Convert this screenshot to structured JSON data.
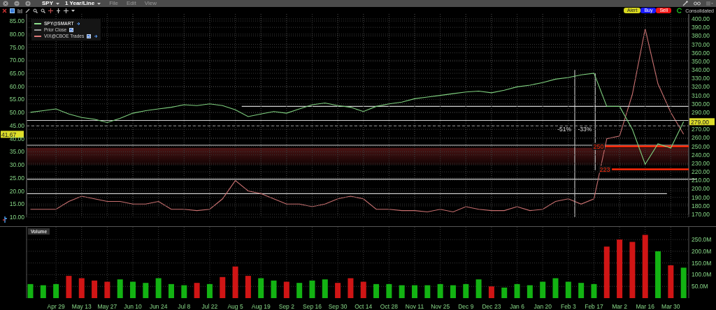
{
  "title_bar": {
    "symbol": "SPY",
    "period": "1 Year/Line",
    "menus": [
      "File",
      "Edit",
      "View"
    ]
  },
  "toolbar": {
    "order_buttons": [
      {
        "label": "Alert",
        "kind": "alert"
      },
      {
        "label": "Buy",
        "kind": "buy"
      },
      {
        "label": "Sell",
        "kind": "sell"
      }
    ],
    "data_source": "Consolidated"
  },
  "legend": [
    {
      "label": "SPY@SMART",
      "kind": "solid",
      "color": "#8ee08e",
      "checked": false,
      "pinned": true
    },
    {
      "label": "Prior Close",
      "kind": "dashed",
      "color": "#9a9a9a",
      "checked": true,
      "pinned": false
    },
    {
      "label": "VIX@CBOE Trades",
      "kind": "solid",
      "color": "#e07a7a",
      "checked": true,
      "pinned": true
    }
  ],
  "price_pane": {
    "vix_plot": {
      "chart_data": {
        "type": "line",
        "categories": [
          null,
          null,
          null,
          null,
          null,
          null,
          null,
          null,
          null,
          null,
          null,
          null,
          null,
          null,
          null,
          null,
          null,
          null,
          null,
          null,
          null,
          null,
          null,
          null,
          null,
          null,
          null,
          null,
          null,
          null,
          null,
          null,
          null,
          null,
          null,
          null,
          null,
          null,
          null,
          null,
          null,
          null,
          null,
          null,
          null,
          null,
          null,
          null,
          null,
          null,
          null,
          null
        ],
        "series": [
          {
            "color": "#c97070",
            "values": [
              13,
              13,
              13,
              16,
              18,
              17,
              16,
              16,
              15,
              15,
              16,
              13,
              13,
              12.5,
              13,
              17,
              24,
              20,
              19,
              17,
              15,
              15,
              14,
              15,
              17,
              18,
              17,
              13,
              13,
              12.5,
              12.5,
              12,
              13,
              12,
              14,
              13,
              12.5,
              12.5,
              14,
              12.5,
              13,
              16,
              17,
              15,
              17,
              40,
              41,
              57,
              82,
              61,
              50,
              41.7
            ]
          }
        ],
        "ylim": [
          10,
          87.7
        ],
        "grid": true,
        "yticks": [
          {
            "value": 85,
            "label": "85.00"
          },
          {
            "value": 80,
            "label": "80.00"
          },
          {
            "value": 75,
            "label": "75.00"
          },
          {
            "value": 70,
            "label": "70.00"
          },
          {
            "value": 65,
            "label": "65.00"
          },
          {
            "value": 60,
            "label": "60.00"
          },
          {
            "value": 55,
            "label": "55.00"
          },
          {
            "value": 50,
            "label": "50.00"
          },
          {
            "value": 45,
            "label": "45.00"
          },
          {
            "value": 40,
            "label": "40.00"
          },
          {
            "value": 35,
            "label": "35.00"
          },
          {
            "value": 30,
            "label": "30.00"
          },
          {
            "value": 25,
            "label": "25.00"
          },
          {
            "value": 20,
            "label": "20.00"
          },
          {
            "value": 15,
            "label": "15.00"
          },
          {
            "value": 10,
            "label": "10.00"
          }
        ],
        "annotations": [
          "41.67"
        ]
      }
    },
    "spy_plot": {
      "chart_data": {
        "type": "line",
        "categories": [
          null,
          null,
          null,
          null,
          null,
          null,
          null,
          null,
          null,
          null,
          null,
          null,
          null,
          null,
          null,
          null,
          null,
          null,
          null,
          null,
          null,
          null,
          null,
          null,
          null,
          null,
          null,
          null,
          null,
          null,
          null,
          null,
          null,
          null,
          null,
          null,
          null,
          null,
          null,
          null,
          null,
          null,
          null,
          null,
          null,
          null,
          null,
          null,
          null,
          null,
          null,
          null
        ],
        "series": [
          {
            "color": "#7fd07f",
            "values": [
              290,
              292,
              294,
              288,
              284,
              282,
              278,
              283,
              289,
              292,
              294,
              296,
              299,
              298,
              300,
              298,
              293,
              285,
              288,
              291,
              289,
              294,
              299,
              301,
              298,
              296,
              291,
              297,
              300,
              302,
              306,
              308,
              310,
              312,
              314,
              315,
              313,
              316,
              320,
              322,
              325,
              329,
              331,
              334,
              336,
              297,
              297,
              270,
              229,
              253,
              248,
              279
            ]
          }
        ],
        "ylim": [
          170,
          400
        ],
        "grid": true,
        "yticks": [
          {
            "value": 400,
            "label": "400.00"
          },
          {
            "value": 390,
            "label": "390.00"
          },
          {
            "value": 380,
            "label": "380.00"
          },
          {
            "value": 370,
            "label": "370.00"
          },
          {
            "value": 360,
            "label": "360.00"
          },
          {
            "value": 350,
            "label": "350.00"
          },
          {
            "value": 340,
            "label": "340.00"
          },
          {
            "value": 330,
            "label": "330.00"
          },
          {
            "value": 320,
            "label": "320.00"
          },
          {
            "value": 310,
            "label": "310.00"
          },
          {
            "value": 300,
            "label": "300.00"
          },
          {
            "value": 290,
            "label": "290.00"
          },
          {
            "value": 270,
            "label": "270.00"
          },
          {
            "value": 260,
            "label": "260.00"
          },
          {
            "value": 250,
            "label": "250.00"
          },
          {
            "value": 240,
            "label": "240.00"
          },
          {
            "value": 230,
            "label": "230.00"
          },
          {
            "value": 220,
            "label": "220.00"
          },
          {
            "value": 210,
            "label": "210.00"
          },
          {
            "value": 200,
            "label": "200.00"
          },
          {
            "value": 190,
            "label": "190.00"
          },
          {
            "value": 180,
            "label": "180.00"
          },
          {
            "value": 170,
            "label": "170.00"
          }
        ],
        "annotations": [
          "-51%",
          "-33%",
          "250",
          "223",
          "279.00"
        ]
      }
    }
  },
  "volume_pane": {
    "label": "Volume",
    "chart_data": {
      "type": "bar",
      "categories": [
        null,
        null,
        "Apr 29",
        null,
        "May 13",
        null,
        "May 27",
        null,
        "Jun 10",
        null,
        "Jun 24",
        null,
        "Jul 8",
        null,
        "Jul 22",
        null,
        "Aug 5",
        null,
        "Aug 19",
        null,
        "Sep 2",
        null,
        "Sep 16",
        null,
        "Sep 30",
        null,
        "Oct 14",
        null,
        "Oct 28",
        null,
        "Nov 11",
        null,
        "Nov 25",
        null,
        "Dec 9",
        null,
        "Dec 23",
        null,
        "Jan 6",
        null,
        "Jan 20",
        null,
        "Feb 3",
        null,
        "Feb 17",
        null,
        "Mar 2",
        null,
        "Mar 16",
        null,
        "Mar 30",
        null
      ],
      "series": [
        {
          "color": "#13b313",
          "values": [
            60,
            55,
            60,
            null,
            null,
            null,
            null,
            80,
            70,
            65,
            85,
            60,
            55,
            null,
            60,
            null,
            null,
            null,
            85,
            75,
            null,
            65,
            75,
            80,
            null,
            null,
            null,
            60,
            60,
            55,
            55,
            55,
            60,
            55,
            60,
            80,
            null,
            45,
            60,
            55,
            70,
            85,
            70,
            65,
            60,
            null,
            null,
            null,
            null,
            200,
            null,
            130
          ]
        },
        {
          "color": "#d01515",
          "values": [
            null,
            null,
            null,
            95,
            85,
            75,
            70,
            null,
            null,
            null,
            null,
            null,
            null,
            65,
            null,
            90,
            135,
            95,
            null,
            null,
            70,
            null,
            null,
            null,
            65,
            85,
            70,
            null,
            null,
            null,
            null,
            null,
            null,
            null,
            null,
            null,
            50,
            null,
            null,
            null,
            null,
            null,
            null,
            null,
            null,
            220,
            250,
            240,
            270,
            null,
            140,
            null
          ]
        }
      ],
      "ylim": [
        0,
        304
      ],
      "grid": true,
      "yticks": [
        {
          "value": 250,
          "label": "250.0M"
        },
        {
          "value": 200,
          "label": "200.0M"
        },
        {
          "value": 150,
          "label": "150.0M"
        },
        {
          "value": 100,
          "label": "100.0M"
        },
        {
          "value": 50,
          "label": "50.0M"
        }
      ]
    }
  }
}
